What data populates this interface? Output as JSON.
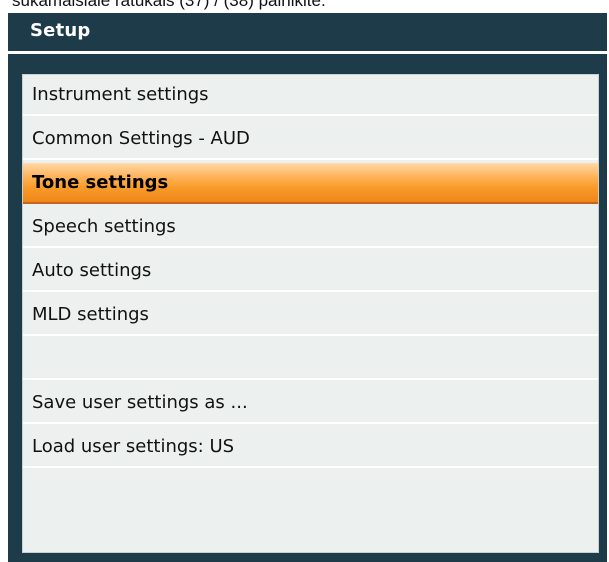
{
  "caption": {
    "text": "sukamaisiale ratukais (37) / (38) painikite."
  },
  "window": {
    "title": "Setup"
  },
  "menu": {
    "items": [
      {
        "label": "Instrument settings",
        "selected": false
      },
      {
        "label": "Common Settings - AUD",
        "selected": false
      },
      {
        "label": "Tone settings",
        "selected": true
      },
      {
        "label": "Speech settings",
        "selected": false
      },
      {
        "label": "Auto settings",
        "selected": false
      },
      {
        "label": "MLD settings",
        "selected": false
      },
      {
        "label": "",
        "selected": false
      },
      {
        "label": "Save user settings as ...",
        "selected": false
      },
      {
        "label": "Load user settings: US",
        "selected": false
      }
    ]
  },
  "colors": {
    "window_background": "#1e3b4a",
    "panel_background": "#ecf0ef",
    "selection_orange": "#f79a28",
    "title_text": "#ffffff"
  }
}
